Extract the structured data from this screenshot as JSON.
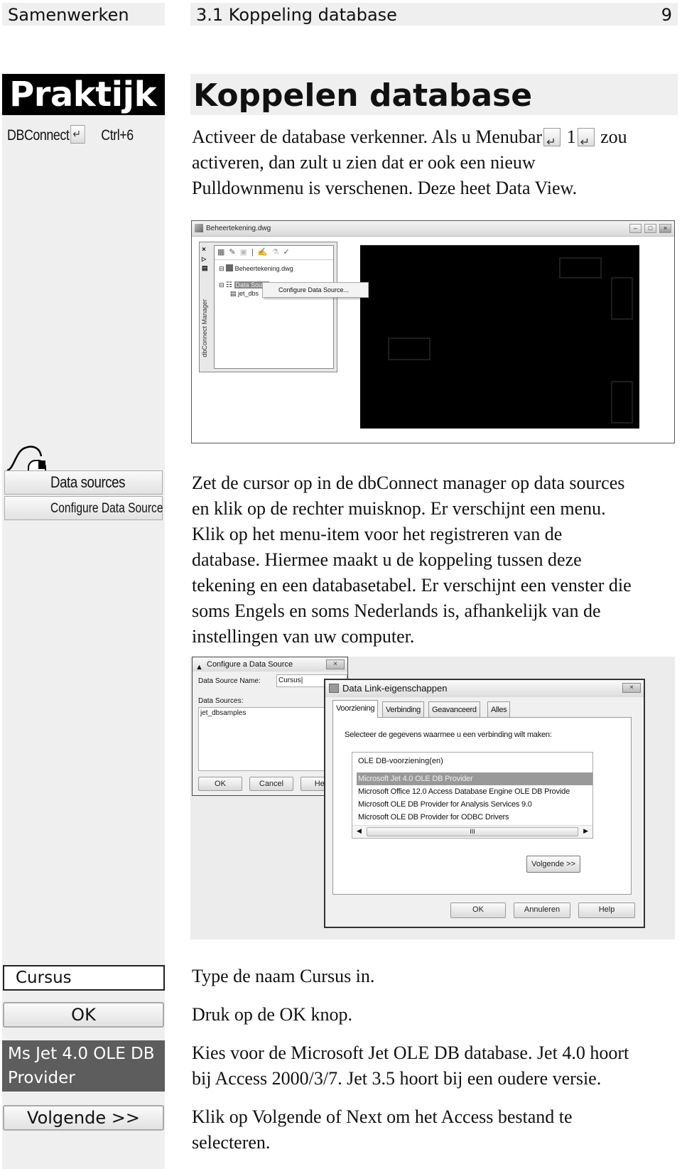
{
  "header": {
    "section": "Samenwerken",
    "chapter": "3.1 Koppeling database",
    "page_number": "9"
  },
  "sidebar": {
    "label": "Praktijk",
    "shortcut_command": "DBConnect",
    "shortcut_keys": "Ctrl+6",
    "mouse_menu": {
      "item1": "Data sources",
      "item2": "Configure Data Source"
    },
    "input_value": "Cursus",
    "ok_button": "OK",
    "provider_label": "Ms Jet 4.0 OLE DB Provider",
    "next_button": "Volgende >>"
  },
  "main": {
    "title": "Koppelen database",
    "intro": {
      "part1": "Activeer de database verkenner. Als u Menubar",
      "part2": "1",
      "part3": "zou",
      "line2": "activeren, dan zult u zien dat er ook een nieuw",
      "line3": "Pulldownmenu is verschenen. Deze heet Data View."
    },
    "paragraph2": [
      "Zet de cursor op in de dbConnect manager op data sources",
      "en klik op de rechter muisknop. Er verschijnt een menu.",
      "Klik op het menu-item voor het registreren van de",
      "database. Hiermee maakt u de koppeling tussen deze",
      "tekening en een databasetabel. Er verschijnt een venster die",
      "soms Engels en soms Nederlands is, afhankelijk van de",
      "instellingen van uw computer."
    ],
    "step_type_name": "Type de naam Cursus in.",
    "step_press_ok": "Druk op de OK knop.",
    "step_choose_provider": [
      "Kies voor de Microsoft Jet OLE DB database. Jet 4.0 hoort",
      "bij Access 2000/3/7. Jet 3.5 hoort bij een oudere versie."
    ],
    "step_next": [
      "Klik op Volgende of Next om het Access bestand te",
      "selecteren."
    ]
  },
  "screenshot1": {
    "window_title": "Beheertekening.dwg",
    "panel_title": "dbConnect Manager",
    "tree": {
      "root": "Beheertekening.dwg",
      "data_sources": "Data Sourc",
      "child": "jet_dbs"
    },
    "context_menu_item": "Configure Data Source..."
  },
  "screenshot2": {
    "configure_dialog": {
      "title": "Configure a Data Source",
      "name_label": "Data Source Name:",
      "name_value": "Cursus",
      "sources_label": "Data Sources:",
      "sources": [
        "jet_dbsamples"
      ],
      "ok": "OK",
      "cancel": "Cancel",
      "help": "Help"
    },
    "datalink_dialog": {
      "title": "Data Link-eigenschappen",
      "tabs": [
        "Voorziening",
        "Verbinding",
        "Geavanceerd",
        "Alles"
      ],
      "instruction": "Selecteer de gegevens waarmee u een verbinding wilt maken:",
      "list_header": "OLE DB-voorziening(en)",
      "providers": [
        "Microsoft Jet 4.0 OLE DB Provider",
        "Microsoft Office 12.0 Access Database Engine OLE DB Provide",
        "Microsoft OLE DB Provider for Analysis Services 9.0",
        "Microsoft OLE DB Provider for ODBC Drivers"
      ],
      "selected_provider": "Microsoft Jet 4.0 OLE DB Provider",
      "next": "Volgende >>",
      "ok": "OK",
      "cancel": "Annuleren",
      "help": "Help"
    }
  }
}
